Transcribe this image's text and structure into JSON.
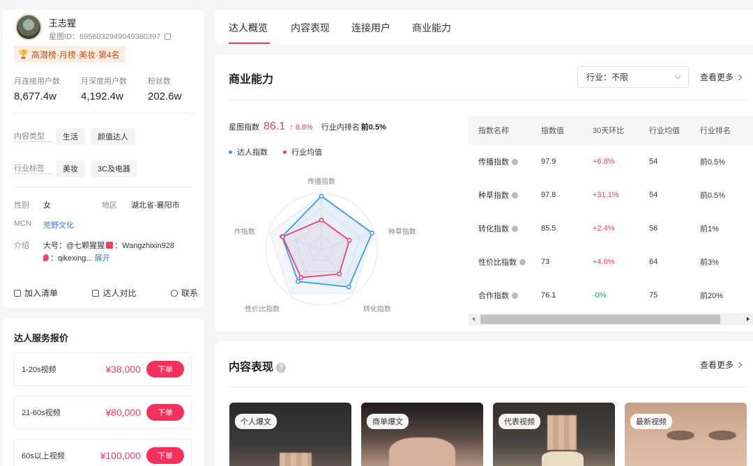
{
  "profile": {
    "name": "王志猩",
    "star_id": "星图ID：6956032949049360397",
    "rank_badge": "高潜榜·月榜·美妆·第4名",
    "stats": [
      {
        "label": "月连接用户数",
        "value": "8,677.4w"
      },
      {
        "label": "月深度用户数",
        "value": "4,192.4w"
      },
      {
        "label": "粉丝数",
        "value": "202.6w"
      }
    ],
    "content_type_label": "内容类型",
    "content_types": [
      "生活",
      "颜值达人"
    ],
    "industry_label": "行业标签",
    "industry_tags": [
      "美妆",
      "3C及电器"
    ],
    "gender_label": "性别",
    "gender": "女",
    "region_label": "地区",
    "region": "湖北省-襄阳市",
    "mcn_label": "MCN",
    "mcn": "荒野文化",
    "intro_label": "介绍",
    "intro_line1a": "大号：@七颗猩猩",
    "intro_line1b": "：Wangzhixin928",
    "intro_line2": "：qikexing...",
    "expand": "展开",
    "actions": [
      "加入清单",
      "达人对比",
      "联系"
    ]
  },
  "pricing": {
    "title": "达人服务报价",
    "items": [
      {
        "name": "1-20s视频",
        "price": "¥38,000",
        "button": "下单"
      },
      {
        "name": "21-60s视频",
        "price": "¥80,000",
        "button": "下单"
      },
      {
        "name": "60s以上视频",
        "price": "¥100,000",
        "button": "下单"
      }
    ]
  },
  "tabs": [
    "达人概览",
    "内容表现",
    "连接用户",
    "商业能力"
  ],
  "business": {
    "title": "商业能力",
    "industry_select": "行业：不限",
    "more": "查看更多",
    "index_label": "星图指数",
    "index_value": "86.1",
    "index_change": "↑ 8.8%",
    "industry_rank_label": "行业内排名",
    "industry_rank": "前0.5%",
    "legend": [
      {
        "name": "达人指数",
        "color": "#3b9be8"
      },
      {
        "name": "行业均值",
        "color": "#ee3f6a"
      }
    ],
    "table_headers": [
      "指数名称",
      "指数值",
      "30天环比",
      "行业均值",
      "行业排名"
    ],
    "table_rows": [
      {
        "name": "传播指数",
        "value": "97.9",
        "change": "+6.8%",
        "avg": "54",
        "rank": "前0.5%"
      },
      {
        "name": "种草指数",
        "value": "97.8",
        "change": "+31.1%",
        "avg": "54",
        "rank": "前0.5%"
      },
      {
        "name": "转化指数",
        "value": "85.5",
        "change": "+2.4%",
        "avg": "56",
        "rank": "前1%"
      },
      {
        "name": "性价比指数",
        "value": "73",
        "change": "+4.6%",
        "avg": "64",
        "rank": "前3%"
      },
      {
        "name": "合作指数",
        "value": "76.1",
        "change": "-0%",
        "avg": "75",
        "rank": "前20%"
      }
    ]
  },
  "chart_data": {
    "type": "radar",
    "axes": [
      "传播指数",
      "种草指数",
      "转化指数",
      "性价比指数",
      "合作指数"
    ],
    "range": [
      0,
      100
    ],
    "series": [
      {
        "name": "达人指数",
        "values": [
          97.9,
          97.8,
          85.5,
          73,
          76.1
        ],
        "color": "#3b9be8"
      },
      {
        "name": "行业均值",
        "values": [
          54,
          54,
          56,
          64,
          75
        ],
        "color": "#ee3f6a"
      }
    ]
  },
  "content": {
    "title": "内容表现",
    "more": "查看更多",
    "thumbnails": [
      "个人爆文",
      "商单爆文",
      "代表视频",
      "最新视频"
    ]
  }
}
